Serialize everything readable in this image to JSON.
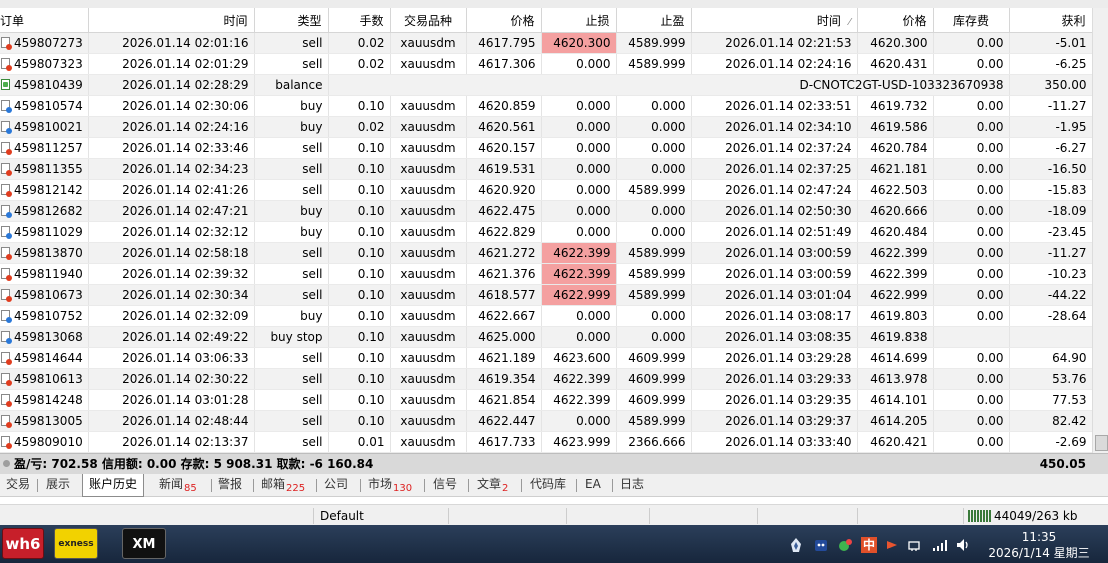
{
  "columns": [
    "订单",
    "时间",
    "类型",
    "手数",
    "交易品种",
    "价格",
    "止损",
    "止盈",
    "时间",
    "价格",
    "库存费",
    "获利"
  ],
  "sort_indicator": "⁄",
  "rows": [
    {
      "order": "459807273",
      "open_time": "2026.01.14 02:01:16",
      "type": "sell",
      "lots": "0.02",
      "symbol": "xauusdm",
      "price": "4617.795",
      "sl": "4620.300",
      "tp": "4589.999",
      "close_time": "2026.01.14 02:21:53",
      "close_price": "4620.300",
      "swap": "0.00",
      "profit": "-5.01",
      "icon": "red",
      "sl_hl": true
    },
    {
      "order": "459807323",
      "open_time": "2026.01.14 02:01:29",
      "type": "sell",
      "lots": "0.02",
      "symbol": "xauusdm",
      "price": "4617.306",
      "sl": "0.000",
      "tp": "4589.999",
      "close_time": "2026.01.14 02:24:16",
      "close_price": "4620.431",
      "swap": "0.00",
      "profit": "-6.25",
      "icon": "red",
      "sl_hl": false
    },
    {
      "order": "459810439",
      "open_time": "2026.01.14 02:28:29",
      "type": "balance",
      "comment": "D-CNOTC2GT-USD-103323670938",
      "profit": "350.00",
      "icon": "green"
    },
    {
      "order": "459810574",
      "open_time": "2026.01.14 02:30:06",
      "type": "buy",
      "lots": "0.10",
      "symbol": "xauusdm",
      "price": "4620.859",
      "sl": "0.000",
      "tp": "0.000",
      "close_time": "2026.01.14 02:33:51",
      "close_price": "4619.732",
      "swap": "0.00",
      "profit": "-11.27",
      "icon": "blue",
      "sl_hl": false
    },
    {
      "order": "459810021",
      "open_time": "2026.01.14 02:24:16",
      "type": "buy",
      "lots": "0.02",
      "symbol": "xauusdm",
      "price": "4620.561",
      "sl": "0.000",
      "tp": "0.000",
      "close_time": "2026.01.14 02:34:10",
      "close_price": "4619.586",
      "swap": "0.00",
      "profit": "-1.95",
      "icon": "blue",
      "sl_hl": false
    },
    {
      "order": "459811257",
      "open_time": "2026.01.14 02:33:46",
      "type": "sell",
      "lots": "0.10",
      "symbol": "xauusdm",
      "price": "4620.157",
      "sl": "0.000",
      "tp": "0.000",
      "close_time": "2026.01.14 02:37:24",
      "close_price": "4620.784",
      "swap": "0.00",
      "profit": "-6.27",
      "icon": "red",
      "sl_hl": false
    },
    {
      "order": "459811355",
      "open_time": "2026.01.14 02:34:23",
      "type": "sell",
      "lots": "0.10",
      "symbol": "xauusdm",
      "price": "4619.531",
      "sl": "0.000",
      "tp": "0.000",
      "close_time": "2026.01.14 02:37:25",
      "close_price": "4621.181",
      "swap": "0.00",
      "profit": "-16.50",
      "icon": "red",
      "sl_hl": false
    },
    {
      "order": "459812142",
      "open_time": "2026.01.14 02:41:26",
      "type": "sell",
      "lots": "0.10",
      "symbol": "xauusdm",
      "price": "4620.920",
      "sl": "0.000",
      "tp": "4589.999",
      "close_time": "2026.01.14 02:47:24",
      "close_price": "4622.503",
      "swap": "0.00",
      "profit": "-15.83",
      "icon": "red",
      "sl_hl": false
    },
    {
      "order": "459812682",
      "open_time": "2026.01.14 02:47:21",
      "type": "buy",
      "lots": "0.10",
      "symbol": "xauusdm",
      "price": "4622.475",
      "sl": "0.000",
      "tp": "0.000",
      "close_time": "2026.01.14 02:50:30",
      "close_price": "4620.666",
      "swap": "0.00",
      "profit": "-18.09",
      "icon": "blue",
      "sl_hl": false
    },
    {
      "order": "459811029",
      "open_time": "2026.01.14 02:32:12",
      "type": "buy",
      "lots": "0.10",
      "symbol": "xauusdm",
      "price": "4622.829",
      "sl": "0.000",
      "tp": "0.000",
      "close_time": "2026.01.14 02:51:49",
      "close_price": "4620.484",
      "swap": "0.00",
      "profit": "-23.45",
      "icon": "blue",
      "sl_hl": false
    },
    {
      "order": "459813870",
      "open_time": "2026.01.14 02:58:18",
      "type": "sell",
      "lots": "0.10",
      "symbol": "xauusdm",
      "price": "4621.272",
      "sl": "4622.399",
      "tp": "4589.999",
      "close_time": "2026.01.14 03:00:59",
      "close_price": "4622.399",
      "swap": "0.00",
      "profit": "-11.27",
      "icon": "red",
      "sl_hl": true
    },
    {
      "order": "459811940",
      "open_time": "2026.01.14 02:39:32",
      "type": "sell",
      "lots": "0.10",
      "symbol": "xauusdm",
      "price": "4621.376",
      "sl": "4622.399",
      "tp": "4589.999",
      "close_time": "2026.01.14 03:00:59",
      "close_price": "4622.399",
      "swap": "0.00",
      "profit": "-10.23",
      "icon": "red",
      "sl_hl": true
    },
    {
      "order": "459810673",
      "open_time": "2026.01.14 02:30:34",
      "type": "sell",
      "lots": "0.10",
      "symbol": "xauusdm",
      "price": "4618.577",
      "sl": "4622.999",
      "tp": "4589.999",
      "close_time": "2026.01.14 03:01:04",
      "close_price": "4622.999",
      "swap": "0.00",
      "profit": "-44.22",
      "icon": "red",
      "sl_hl": true
    },
    {
      "order": "459810752",
      "open_time": "2026.01.14 02:32:09",
      "type": "buy",
      "lots": "0.10",
      "symbol": "xauusdm",
      "price": "4622.667",
      "sl": "0.000",
      "tp": "0.000",
      "close_time": "2026.01.14 03:08:17",
      "close_price": "4619.803",
      "swap": "0.00",
      "profit": "-28.64",
      "icon": "blue",
      "sl_hl": false
    },
    {
      "order": "459813068",
      "open_time": "2026.01.14 02:49:22",
      "type": "buy stop",
      "lots": "0.10",
      "symbol": "xauusdm",
      "price": "4625.000",
      "sl": "0.000",
      "tp": "0.000",
      "close_time": "2026.01.14 03:08:35",
      "close_price": "4619.838",
      "swap": "",
      "profit": "",
      "icon": "blue",
      "sl_hl": false
    },
    {
      "order": "459814644",
      "open_time": "2026.01.14 03:06:33",
      "type": "sell",
      "lots": "0.10",
      "symbol": "xauusdm",
      "price": "4621.189",
      "sl": "4623.600",
      "tp": "4609.999",
      "close_time": "2026.01.14 03:29:28",
      "close_price": "4614.699",
      "swap": "0.00",
      "profit": "64.90",
      "icon": "red",
      "sl_hl": false
    },
    {
      "order": "459810613",
      "open_time": "2026.01.14 02:30:22",
      "type": "sell",
      "lots": "0.10",
      "symbol": "xauusdm",
      "price": "4619.354",
      "sl": "4622.399",
      "tp": "4609.999",
      "close_time": "2026.01.14 03:29:33",
      "close_price": "4613.978",
      "swap": "0.00",
      "profit": "53.76",
      "icon": "red",
      "sl_hl": false
    },
    {
      "order": "459814248",
      "open_time": "2026.01.14 03:01:28",
      "type": "sell",
      "lots": "0.10",
      "symbol": "xauusdm",
      "price": "4621.854",
      "sl": "4622.399",
      "tp": "4609.999",
      "close_time": "2026.01.14 03:29:35",
      "close_price": "4614.101",
      "swap": "0.00",
      "profit": "77.53",
      "icon": "red",
      "sl_hl": false
    },
    {
      "order": "459813005",
      "open_time": "2026.01.14 02:48:44",
      "type": "sell",
      "lots": "0.10",
      "symbol": "xauusdm",
      "price": "4622.447",
      "sl": "0.000",
      "tp": "4589.999",
      "close_time": "2026.01.14 03:29:37",
      "close_price": "4614.205",
      "swap": "0.00",
      "profit": "82.42",
      "icon": "red",
      "sl_hl": false
    },
    {
      "order": "459809010",
      "open_time": "2026.01.14 02:13:37",
      "type": "sell",
      "lots": "0.01",
      "symbol": "xauusdm",
      "price": "4617.733",
      "sl": "4623.999",
      "tp": "2366.666",
      "close_time": "2026.01.14 03:33:40",
      "close_price": "4620.421",
      "swap": "0.00",
      "profit": "-2.69",
      "icon": "red",
      "sl_hl": false
    }
  ],
  "summary": {
    "text": "盈/亏: 702.58  信用额: 0.00  存款: 5 908.31  取款: -6 160.84",
    "total": "450.05"
  },
  "tabs": [
    {
      "label": "交易",
      "badge": ""
    },
    {
      "label": "展示",
      "badge": ""
    },
    {
      "label": "账户历史",
      "badge": "",
      "active": true
    },
    {
      "label": "新闻",
      "badge": "85"
    },
    {
      "label": "警报",
      "badge": ""
    },
    {
      "label": "邮箱",
      "badge": "225"
    },
    {
      "label": "公司",
      "badge": ""
    },
    {
      "label": "市场",
      "badge": "130"
    },
    {
      "label": "信号",
      "badge": ""
    },
    {
      "label": "文章",
      "badge": "2"
    },
    {
      "label": "代码库",
      "badge": ""
    },
    {
      "label": "EA",
      "badge": ""
    },
    {
      "label": "日志",
      "badge": ""
    }
  ],
  "status": {
    "profile": "Default",
    "traffic": "44049/263 kb"
  },
  "taskbar": {
    "apps": [
      "wh6",
      "exness",
      "XM"
    ],
    "tray_ime": "中",
    "clock_time": "11:35",
    "clock_date": "2026/1/14 星期三"
  },
  "colors": {
    "stop_loss_highlight": "#f4a0a0",
    "sell_icon": "#e03c1e",
    "buy_icon": "#2a78d8",
    "balance_icon": "#4cae4c",
    "badge": "#dd2222",
    "summary_bar": "#d9d9d9",
    "taskbar": "#1f3350"
  }
}
